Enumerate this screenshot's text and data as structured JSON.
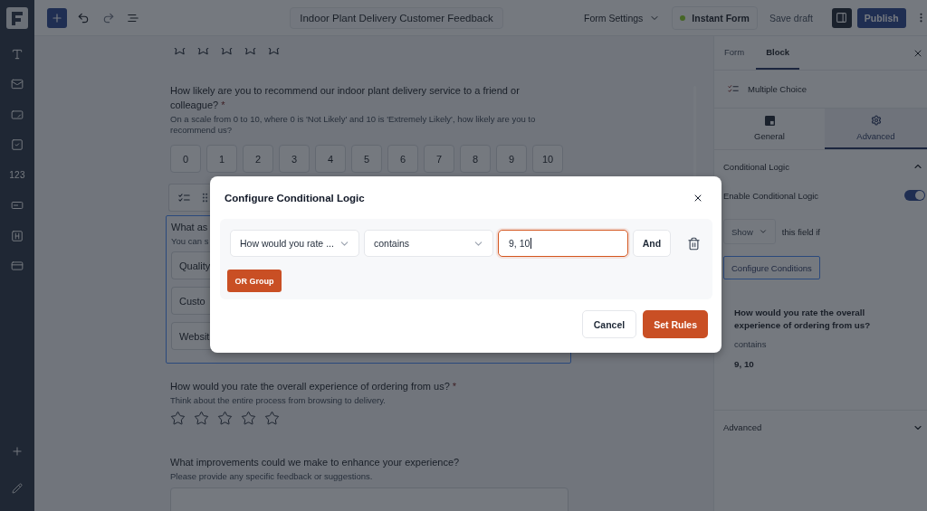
{
  "rail": {
    "items": [
      {
        "kind": "text"
      },
      {
        "kind": "email"
      },
      {
        "kind": "input"
      },
      {
        "kind": "checkbox"
      },
      {
        "kind": "number",
        "label": "123"
      },
      {
        "kind": "range"
      },
      {
        "kind": "heading"
      },
      {
        "kind": "payment"
      }
    ],
    "bottom_items": [
      {
        "kind": "add"
      },
      {
        "kind": "edit"
      }
    ]
  },
  "top_bar": {
    "undo": {
      "disabled": false
    },
    "redo": {
      "disabled": true
    },
    "title": "Indoor Plant Delivery Customer Feedback",
    "form_settings": "Form Settings",
    "instant_form": "Instant Form",
    "save_draft": {
      "label": "Save draft",
      "disabled": true
    },
    "panel_toggle": {
      "selected": true
    },
    "publish": "Publish"
  },
  "canvas": {
    "top_rating": {
      "stars": 0
    },
    "questions": [
      {
        "kind": "nps",
        "selected": false,
        "title": "How likely are you to recommend our indoor plant delivery service to a friend or colleague?",
        "required_mark": "*",
        "description": "On a scale from 0 to 10, where 0 is 'Not Likely' and 10 is 'Extremely Likely', how likely are you to recommend us?",
        "options": [
          "0",
          "1",
          "2",
          "3",
          "4",
          "5",
          "6",
          "7",
          "8",
          "9",
          "10"
        ]
      },
      {
        "kind": "choice",
        "selected": true,
        "title": "What as",
        "description": "You can s",
        "options": [
          "Quality",
          "Custo",
          "Websit"
        ]
      },
      {
        "kind": "rating",
        "selected": false,
        "title": "How would you rate the overall experience of ordering from us?",
        "required_mark": "*",
        "description": "Think about the entire process from browsing to delivery.",
        "stars": 0
      },
      {
        "kind": "long_text",
        "selected": false,
        "title": "What improvements could we make to enhance your experience?",
        "description": "Please provide any specific feedback or suggestions."
      }
    ]
  },
  "panel": {
    "tabs": [
      {
        "label": "Form",
        "selected": false
      },
      {
        "label": "Block",
        "selected": true
      }
    ],
    "block_type": "Multiple Choice",
    "sub_tabs": [
      {
        "kind": "general",
        "label": "General",
        "selected": false
      },
      {
        "kind": "advanced",
        "label": "Advanced",
        "selected": true
      }
    ],
    "conditional_logic": {
      "title": "Conditional Logic",
      "expanded": true,
      "toggle_label": "Enable Conditional Logic",
      "enabled": true,
      "action": "Show",
      "action_suffix": "this field if",
      "configure_button": "Configure Conditions",
      "summary": {
        "field": "How would you rate the overall experience of ordering from us?",
        "operator": "contains",
        "value": "9, 10"
      }
    },
    "advanced": {
      "title": "Advanced",
      "expanded": false
    }
  },
  "modal": {
    "title": "Configure Conditional Logic",
    "conditions": [
      {
        "field": "How would you rate ...",
        "operator": "contains",
        "value": "9, 10",
        "focused": true,
        "join": "And"
      }
    ],
    "or_group": "OR Group",
    "buttons": [
      {
        "kind": "secondary",
        "label": "Cancel"
      },
      {
        "kind": "primary",
        "label": "Set Rules"
      }
    ]
  }
}
